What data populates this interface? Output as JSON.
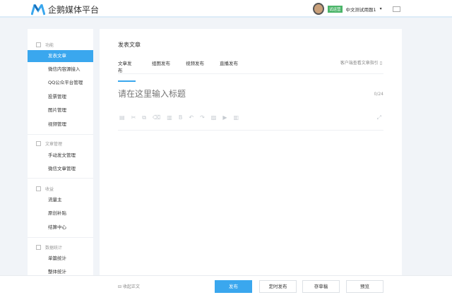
{
  "header": {
    "logo_text": "企鹅媒体平台",
    "badge": "试运营",
    "username": "中文测试用题1",
    "dropdown": "▾"
  },
  "sidebar": {
    "sections": [
      {
        "label": "功能",
        "items": [
          "发表文章",
          "微信内容源接入",
          "QQ公众平台管理",
          "投票管理",
          "图片管理",
          "视频管理"
        ]
      },
      {
        "label": "文章管理",
        "items": [
          "手动发文管理",
          "微信文章管理"
        ]
      },
      {
        "label": "收益",
        "items": [
          "流量主",
          "原创补贴",
          "结算中心"
        ]
      },
      {
        "label": "数据统计",
        "items": [
          "单篇统计",
          "整体统计"
        ]
      }
    ],
    "active": "发表文章"
  },
  "main": {
    "title": "发表文章",
    "tabs": [
      "文章发布",
      "组图发布",
      "视频发布",
      "直播发布"
    ],
    "guide": "客户端查看文章指引",
    "title_placeholder": "请在这里输入标题",
    "count": "0/24",
    "toolbar": [
      "▤",
      "✂",
      "⧉",
      "⌫",
      "▥",
      "B",
      "↶",
      "↷",
      "▨",
      "▶",
      "▥"
    ],
    "expand": "⤢"
  },
  "footer": {
    "collapse": "收起正文",
    "buttons": [
      "发布",
      "定时发布",
      "存草稿",
      "预览"
    ]
  },
  "colors": {
    "accent": "#3aa7ee",
    "badge": "#4cb56a"
  }
}
